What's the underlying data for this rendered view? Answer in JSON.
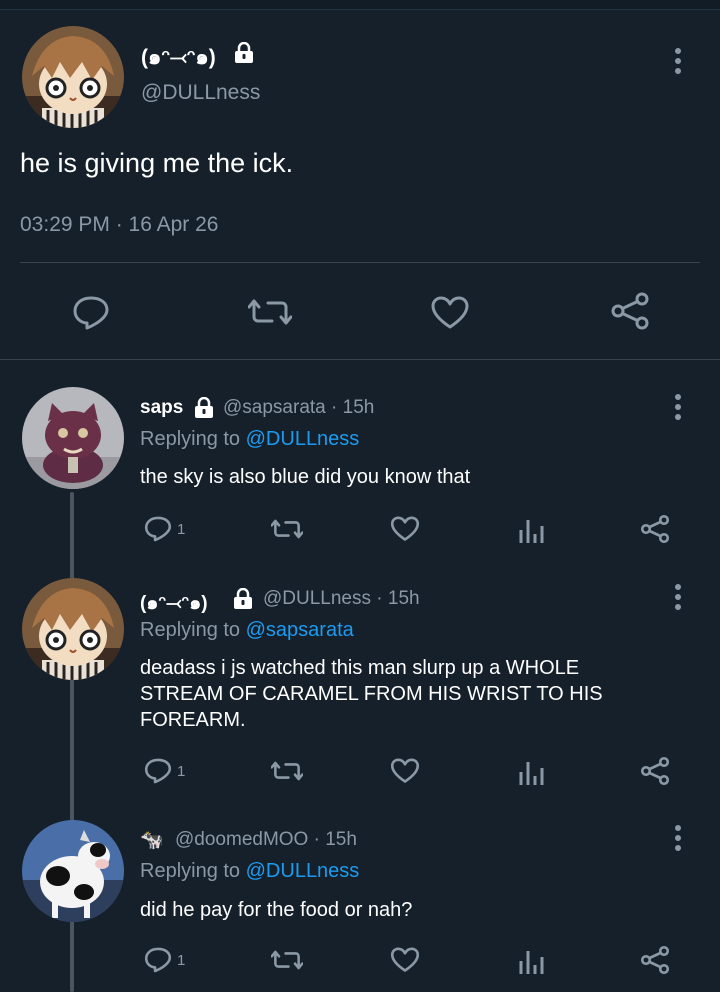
{
  "main_tweet": {
    "display_name": "(๑ᵔ⤙ᵔ๑)",
    "handle": "@DULLness",
    "text": "he is giving me the ick.",
    "timestamp": "03:29 PM · 16 Apr 26"
  },
  "replies": [
    {
      "display_name": "saps",
      "handle": "@sapsarata",
      "sep": "·",
      "time": "15h",
      "replying_prefix": "Replying to",
      "replying_to": "@DULLness",
      "text": "the sky is also blue did you know that",
      "reply_count": "1"
    },
    {
      "display_name": "(๑ᵔ⤙ᵔ๑)",
      "handle": "@DULLness",
      "sep": "·",
      "time": "15h",
      "replying_prefix": "Replying to",
      "replying_to": "@sapsarata",
      "text": "deadass i js watched this man slurp up a WHOLE STREAM OF CARAMEL FROM HIS WRIST TO HIS FOREARM.",
      "reply_count": "1"
    },
    {
      "display_name": "🐄",
      "handle": "@doomedMOO",
      "sep": "·",
      "time": "15h",
      "replying_prefix": "Replying to",
      "replying_to": "@DULLness",
      "text": "did he pay for the food or nah?",
      "reply_count": "1"
    }
  ],
  "colors": {
    "background": "#15202b",
    "muted": "#8b98a5",
    "link": "#1d9bf0",
    "divider": "#38444d"
  },
  "icons": [
    "lock-icon",
    "more-vertical-icon",
    "reply-icon",
    "retweet-icon",
    "like-icon",
    "share-icon",
    "analytics-icon"
  ]
}
